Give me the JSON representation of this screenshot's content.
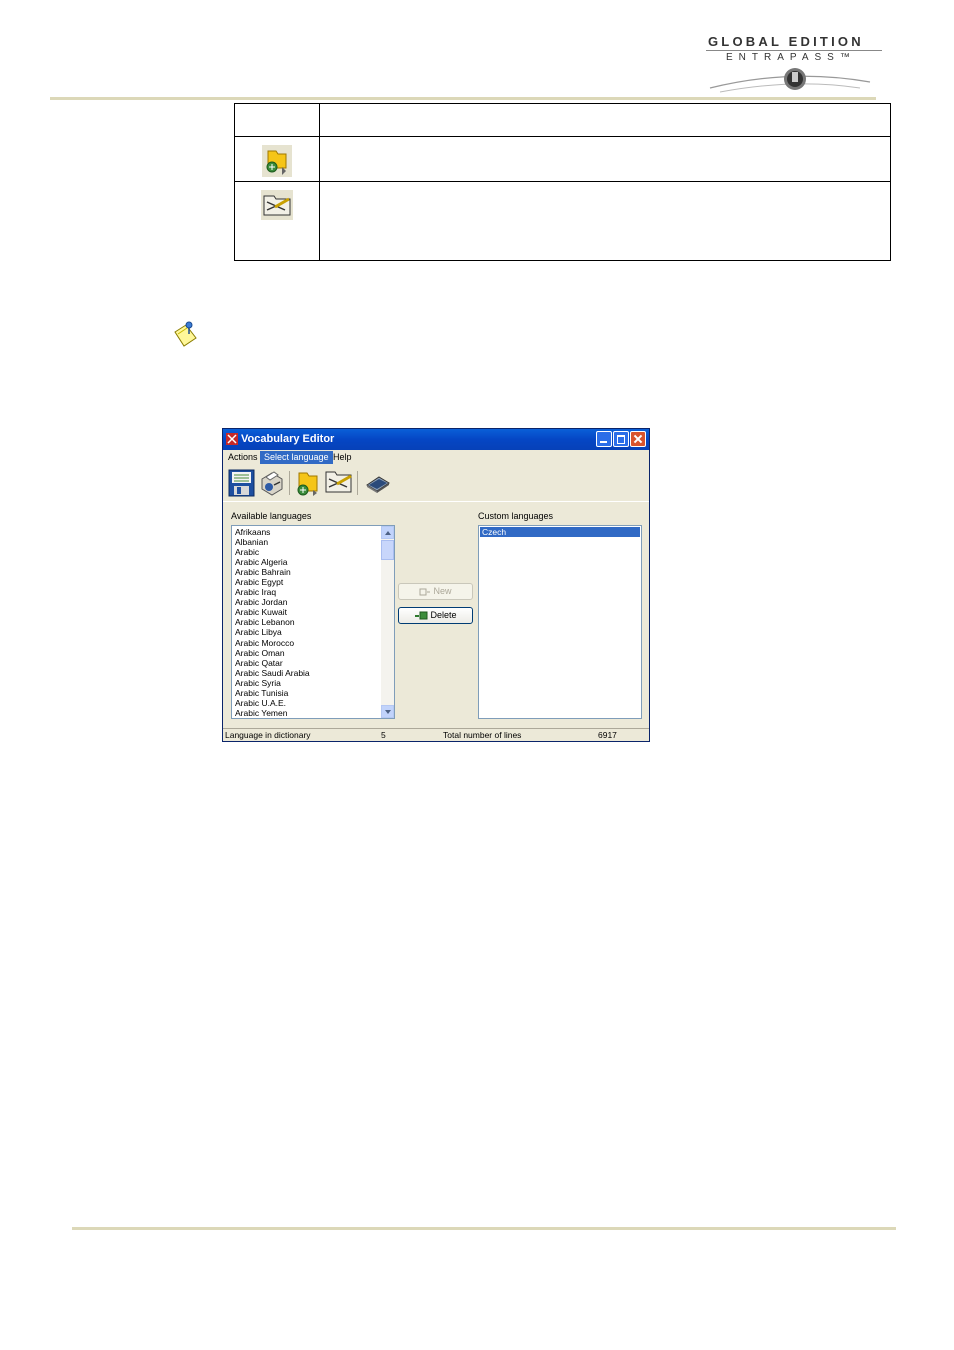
{
  "header": {
    "logo_line1": "GLOBAL EDITION",
    "logo_line2": "ENTRAPASS™"
  },
  "icon_table": {
    "rows": [
      {
        "icon": "none",
        "text": ""
      },
      {
        "icon": "select-language-icon",
        "text": ""
      },
      {
        "icon": "edit-language-icon",
        "text": ""
      }
    ]
  },
  "note": {
    "icon": "note-icon"
  },
  "window": {
    "title": "Vocabulary Editor",
    "menu": [
      "Actions",
      "Select language",
      "Help"
    ],
    "active_menu": "Select language",
    "toolbar_icons": [
      "save-icon",
      "print-icon",
      "select-language-icon",
      "edit-language-icon",
      "laptop-icon"
    ],
    "available_label": "Available languages",
    "available_languages": [
      "Afrikaans",
      "Albanian",
      "Arabic",
      "Arabic Algeria",
      "Arabic Bahrain",
      "Arabic Egypt",
      "Arabic Iraq",
      "Arabic Jordan",
      "Arabic Kuwait",
      "Arabic Lebanon",
      "Arabic Libya",
      "Arabic Morocco",
      "Arabic Oman",
      "Arabic Qatar",
      "Arabic Saudi Arabia",
      "Arabic Syria",
      "Arabic Tunisia",
      "Arabic U.A.E.",
      "Arabic Yemen"
    ],
    "custom_label": "Custom languages",
    "custom_languages": [
      "Czech"
    ],
    "new_button": "New",
    "delete_button": "Delete",
    "status": {
      "language_label": "Language in dictionary",
      "language_count": "5",
      "lines_label": "Total number of lines",
      "lines_count": "6917"
    }
  },
  "colors": {
    "title_bar": "#0546c4",
    "selection": "#316ac5",
    "window_bg": "#ece9d8",
    "rule": "#dcd8b8"
  }
}
